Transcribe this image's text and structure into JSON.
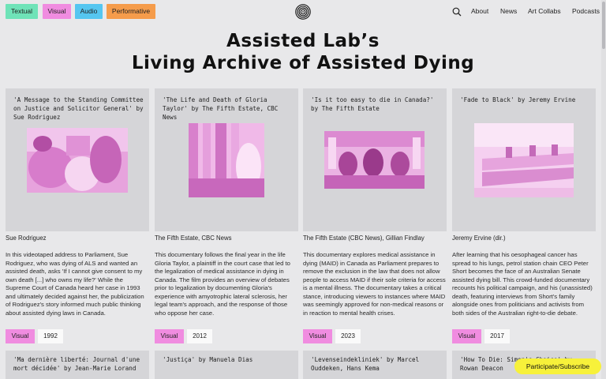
{
  "filters": [
    "Textual",
    "Visual",
    "Audio",
    "Performative"
  ],
  "nav": [
    "About",
    "News",
    "Art Collabs",
    "Podcasts"
  ],
  "title_line1": "Assisted Lab’s",
  "title_line2": "Living Archive of Assisted Dying",
  "cards": [
    {
      "title": "'A Message to the Standing Committee on Justice and Solicitor General' by Sue Rodriguez",
      "credit": "Sue Rodriguez",
      "description": "In this videotaped address to Parliament, Sue Rodriguez, who was dying of ALS and wanted an assisted death, asks 'If I cannot give consent to my own death [...] who owns my life?' While the Supreme Court of Canada heard her case in 1993 and ultimately decided against her, the publicization of Rodriguez's story informed much public thinking about assisted dying laws in Canada.",
      "medium": "Visual",
      "year": "1992"
    },
    {
      "title": "'The Life and Death of Gloria Taylor' by The Fifth Estate, CBC News",
      "credit": "The Fifth Estate, CBC News",
      "description": "This documentary follows the final year in the life Gloria Taylor, a plaintiff in the court case that led to the legalization of medical assistance in dying in Canada. The film provides an overview of debates prior to legalization by documenting Gloria's experience with amyotrophic lateral sclerosis, her legal team's approach, and the response of those who oppose her case.",
      "medium": "Visual",
      "year": "2012"
    },
    {
      "title": "'Is it too easy to die in Canada?' by The Fifth Estate",
      "credit": "The Fifth Estate (CBC News), Gillian Findlay",
      "description": "This documentary explores medical assistance in dying (MAID) in Canada as Parliament prepares to remove the exclusion in the law that does not allow people to access MAID if their sole criteria for access is a mental illness. The documentary takes a critical stance, introducing viewers to instances where MAID was seemingly approved for non-medical reasons or in reaction to mental health crises.",
      "medium": "Visual",
      "year": "2023"
    },
    {
      "title": "'Fade to Black' by Jeremy Ervine",
      "credit": "Jeremy Ervine (dir.)",
      "description": "After learning that his oesophageal cancer has spread to his lungs, petrol station chain CEO Peter Short becomes the face of an Australian Senate assisted dying bill. This crowd-funded documentary recounts his political campaign, and his (unassisted) death, featuring interviews from Short's family alongside ones from politicians and activists from both sides of the Australian right-to-die debate.",
      "medium": "Visual",
      "year": "2017"
    }
  ],
  "next_row": [
    "'Ma dernière liberté: Journal d'une mort décidée' by Jean-Marie Lorand",
    "'Justiça' by Manuela Dias",
    "'Levenseindekliniek' by Marcel Ouddeken, Hans Kema",
    "'How To Die: Simon's Choice' by Rowan Deacon"
  ],
  "subscribe": "Participate/Subscribe",
  "colors": {
    "background": "#e8e8ea",
    "textual": "#6fe3b8",
    "visual": "#f08ce0",
    "audio": "#55c6f0",
    "performative": "#f59c4b",
    "subscribe": "#f7f13a"
  },
  "icons": [
    "spiral-logo-icon",
    "search-icon"
  ]
}
